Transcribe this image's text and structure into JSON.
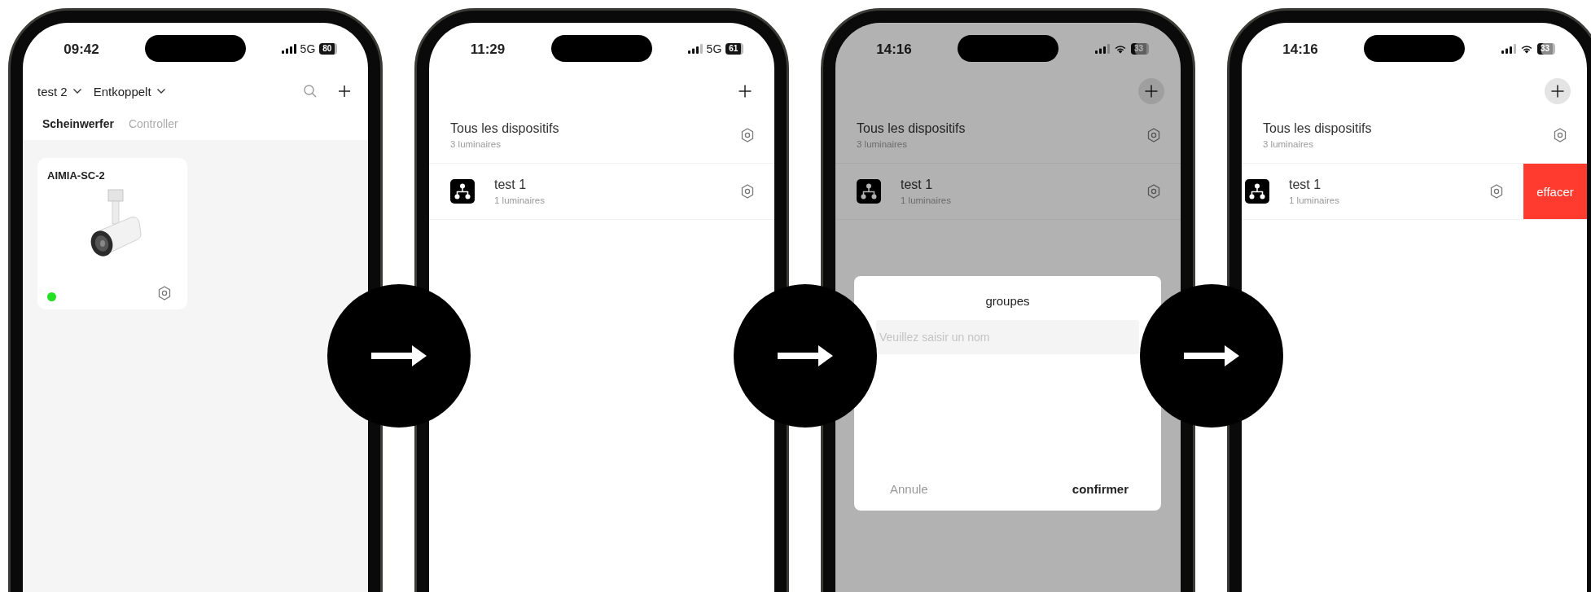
{
  "screens": [
    {
      "kind": "devices",
      "status": {
        "time": "09:42",
        "network": "5G",
        "wifi": false,
        "battery": "80"
      },
      "selectors": [
        "test 2",
        "Entkoppelt"
      ],
      "tabs": [
        {
          "label": "Scheinwerfer",
          "selected": true
        },
        {
          "label": "Controller",
          "selected": false
        }
      ],
      "cards": [
        {
          "name": "AIMIA-SC-2",
          "online": true
        }
      ]
    },
    {
      "kind": "groups",
      "status": {
        "time": "11:29",
        "network": "5G",
        "wifi": false,
        "battery": "61"
      },
      "add_highlighted": false,
      "groups": [
        {
          "kind": "all",
          "name": "Tous les dispositifs",
          "count": "3 luminaires",
          "swiped": false
        },
        {
          "kind": "group",
          "name": "test 1",
          "count": "1 luminaires",
          "swiped": false
        }
      ]
    },
    {
      "kind": "groups",
      "status": {
        "time": "14:16",
        "wifi": true,
        "battery": "33"
      },
      "add_highlighted": true,
      "groups": [
        {
          "kind": "all",
          "name": "Tous les dispositifs",
          "count": "3 luminaires",
          "swiped": false
        },
        {
          "kind": "group",
          "name": "test 1",
          "count": "1 luminaires",
          "swiped": false
        }
      ],
      "dialog": {
        "title": "groupes",
        "placeholder": "Veuillez saisir un nom",
        "buttons": [
          "Annule",
          "confirmer"
        ]
      }
    },
    {
      "kind": "groups",
      "status": {
        "time": "14:16",
        "wifi": true,
        "battery": "33"
      },
      "add_highlighted": true,
      "groups": [
        {
          "kind": "all",
          "name": "Tous les dispositifs",
          "count": "3 luminaires",
          "swiped": false
        },
        {
          "kind": "group",
          "name": "test 1",
          "count": "1 luminaires",
          "swiped": true,
          "action": "effacer"
        }
      ]
    }
  ]
}
